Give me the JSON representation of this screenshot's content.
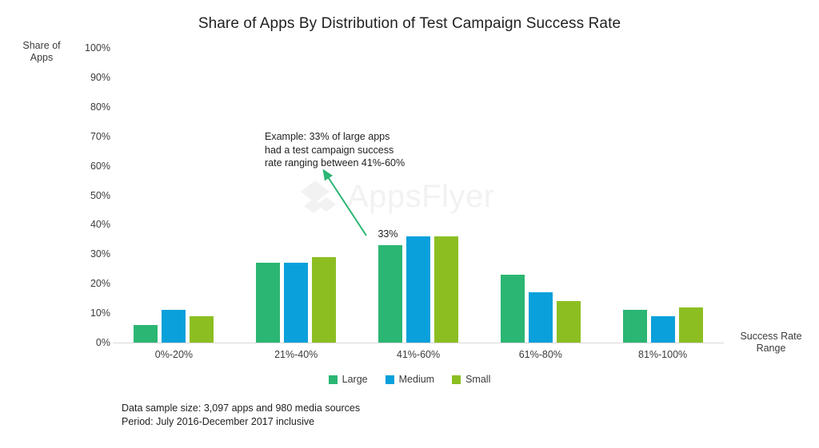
{
  "chart_data": {
    "type": "bar",
    "title": "Share of Apps By Distribution of Test Campaign Success Rate",
    "xlabel": "Success Rate Range",
    "ylabel": "Share of Apps",
    "categories": [
      "0%-20%",
      "21%-40%",
      "41%-60%",
      "61%-80%",
      "81%-100%"
    ],
    "series": [
      {
        "name": "Large",
        "color": "#2bb673",
        "values": [
          6,
          27,
          33,
          23,
          11
        ]
      },
      {
        "name": "Medium",
        "color": "#0aa0db",
        "values": [
          11,
          27,
          36,
          17,
          9
        ]
      },
      {
        "name": "Small",
        "color": "#8cbe22",
        "values": [
          9,
          29,
          36,
          14,
          12
        ]
      }
    ],
    "ylim": [
      0,
      100
    ],
    "ytick_step": 10,
    "ytick_labels": [
      "100%",
      "90%",
      "80%",
      "70%",
      "60%",
      "50%",
      "40%",
      "30%",
      "20%",
      "10%",
      "0%"
    ],
    "grid": false,
    "legend_position": "bottom",
    "data_labels": [
      {
        "series": "Large",
        "category": "41%-60%",
        "text": "33%"
      }
    ],
    "annotations": [
      {
        "text": "Example: 33% of large apps had a test campaign success rate ranging between 41%-60%",
        "lines": [
          "Example: 33% of large apps",
          "had a test campaign success",
          "rate ranging between 41%-60%"
        ],
        "arrow_color": "#2bb673",
        "points_to": {
          "series": "Large",
          "category": "41%-60%"
        }
      }
    ]
  },
  "footnotes": {
    "line1": "Data sample size: 3,097 apps and 980 media sources",
    "line2": "Period: July 2016-December 2017 inclusive"
  },
  "watermark": {
    "brand": "AppsFlyer",
    "color": "#f2f2f2",
    "logo_icon": "appsflyer-logo-icon"
  }
}
